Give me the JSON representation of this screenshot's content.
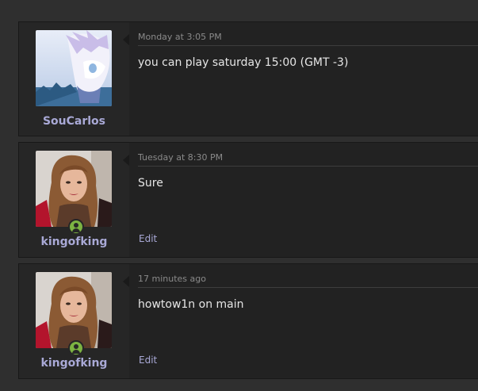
{
  "posts": [
    {
      "username": "SouCarlos",
      "time": "Monday at 3:05 PM",
      "message": "you can play saturday 15:00 (GMT -3)",
      "online": false
    },
    {
      "username": "kingofking",
      "time": "Tuesday at 8:30 PM",
      "message": "Sure",
      "edit_label": "Edit",
      "online": true
    },
    {
      "username": "kingofking",
      "time": "17 minutes ago",
      "message": "howtow1n on main",
      "edit_label": "Edit",
      "online": true
    }
  ],
  "colors": {
    "page_bg": "#2f2f2f",
    "post_bg": "#222222",
    "user_panel_bg": "#262626",
    "username": "#a9a9d6",
    "online": "#7cb342"
  }
}
